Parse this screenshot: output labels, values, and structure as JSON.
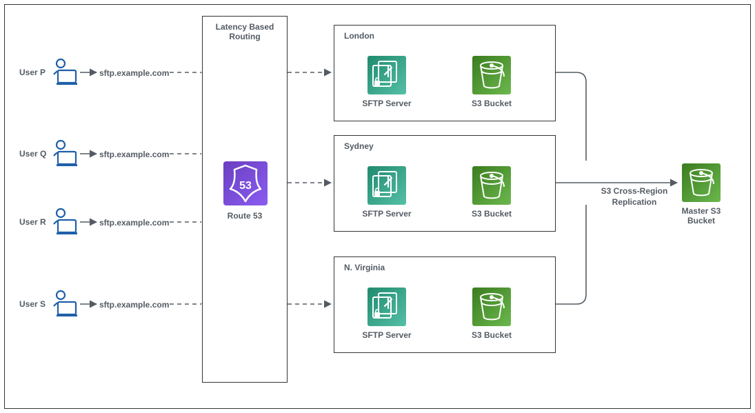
{
  "users": [
    {
      "name": "User P",
      "host": "sftp.example.com"
    },
    {
      "name": "User Q",
      "host": "sftp.example.com"
    },
    {
      "name": "User R",
      "host": "sftp.example.com"
    },
    {
      "name": "User S",
      "host": "sftp.example.com"
    }
  ],
  "routing": {
    "box_title": "Latency Based Routing",
    "service_label": "Route 53",
    "service_number": "53"
  },
  "regions": [
    {
      "name": "London",
      "sftp_label": "SFTP Server",
      "bucket_label": "S3 Bucket"
    },
    {
      "name": "Sydney",
      "sftp_label": "SFTP Server",
      "bucket_label": "S3 Bucket"
    },
    {
      "name": "N. Virginia",
      "sftp_label": "SFTP Server",
      "bucket_label": "S3 Bucket"
    }
  ],
  "replication": {
    "label": "S3 Cross-Region Replication",
    "master_label": "Master S3 Bucket"
  }
}
